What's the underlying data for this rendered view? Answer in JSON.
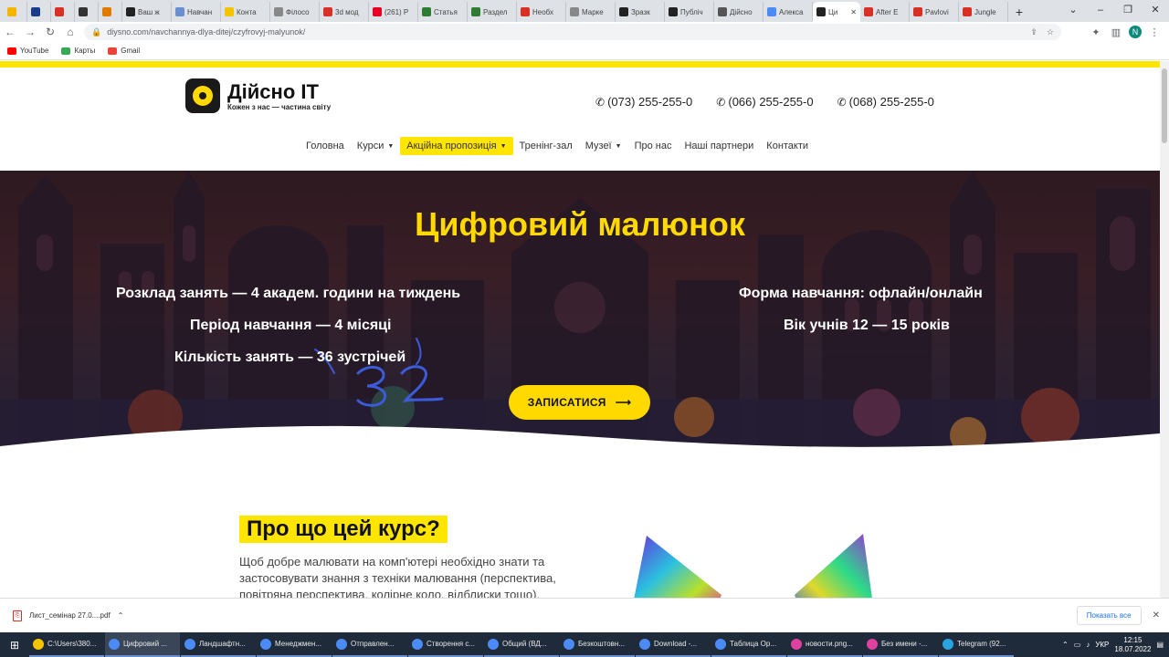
{
  "browser": {
    "tabs": [
      {
        "label": "",
        "color": "#f5b400"
      },
      {
        "label": "",
        "color": "#1a3c8a"
      },
      {
        "label": "",
        "color": "#d93025"
      },
      {
        "label": "",
        "color": "#333333"
      },
      {
        "label": "",
        "color": "#e07b00"
      },
      {
        "label": "Ваш ж",
        "color": "#222222"
      },
      {
        "label": "Навчан",
        "color": "#6a8fcf"
      },
      {
        "label": "Конта",
        "color": "#f5c400"
      },
      {
        "label": "Філосо",
        "color": "#888888"
      },
      {
        "label": "3d мод",
        "color": "#d93025"
      },
      {
        "label": "(261) P",
        "color": "#e60023"
      },
      {
        "label": "Статья",
        "color": "#2e7d32"
      },
      {
        "label": "Раздел",
        "color": "#2e7d32"
      },
      {
        "label": "Необх",
        "color": "#d93025"
      },
      {
        "label": "Марке",
        "color": "#888888"
      },
      {
        "label": "Зразк",
        "color": "#222222"
      },
      {
        "label": "Публіч",
        "color": "#222222"
      },
      {
        "label": "Дійсно",
        "color": "#555555"
      },
      {
        "label": "Алекса",
        "color": "#4c8bf5"
      },
      {
        "label": "Ци",
        "color": "#222222",
        "active": true
      },
      {
        "label": "After E",
        "color": "#d93025"
      },
      {
        "label": "Pavlovi",
        "color": "#d93025"
      },
      {
        "label": "Jungle",
        "color": "#d93025"
      }
    ],
    "url": "diysno.com/navchannya-dlya-ditej/czyfrovyj-malyunok/",
    "profile_initial": "N",
    "bookmarks": [
      {
        "label": "YouTube",
        "color": "#ff0000"
      },
      {
        "label": "Карты",
        "color": "#34a853"
      },
      {
        "label": "Gmail",
        "color": "#ea4335"
      }
    ]
  },
  "site": {
    "logo_title": "Дійсно IT",
    "logo_sub": "Кожен з нас — частина світу",
    "phones": [
      "(073) 255-255-0",
      "(066) 255-255-0",
      "(068) 255-255-0"
    ],
    "nav": [
      {
        "label": "Головна"
      },
      {
        "label": "Курси",
        "dropdown": true
      },
      {
        "label": "Акційна пропозиція",
        "dropdown": true,
        "highlight": true
      },
      {
        "label": "Тренінг-зал"
      },
      {
        "label": "Музеї",
        "dropdown": true
      },
      {
        "label": "Про нас"
      },
      {
        "label": "Наші партнери"
      },
      {
        "label": "Контакти"
      }
    ],
    "hero": {
      "title": "Цифровий малюнок",
      "schedule": "Розклад занять — 4 академ. години на тиждень",
      "period": "Період навчання — 4 місяці",
      "count": "Кількість занять — 36 зустрічей",
      "handwritten": "32",
      "form": "Форма навчання: офлайн/онлайн",
      "age": "Вік учнів 12 — 15 років",
      "cta": "ЗАПИСАТИСЯ"
    },
    "about": {
      "title": "Про що цей курс?",
      "text": "Щоб добре малювати на комп'ютері необхідно знати та застосовувати знання з техніки малювання (перспектива, повітряна перспектива, колірне коло, відблиски тощо)."
    }
  },
  "downloads": {
    "file": "Лист_семінар 27.0....pdf",
    "show_all": "Показать все"
  },
  "taskbar": {
    "items": [
      {
        "label": "C:\\Users\\380...",
        "color": "#f5c400"
      },
      {
        "label": "Цифровий ...",
        "color": "#4c8bf5",
        "active": true
      },
      {
        "label": "Ландшафтн...",
        "color": "#4c8bf5"
      },
      {
        "label": "Менеджмен...",
        "color": "#4c8bf5"
      },
      {
        "label": "Отправлен...",
        "color": "#4c8bf5"
      },
      {
        "label": "Створення с...",
        "color": "#4c8bf5"
      },
      {
        "label": "Общий (ВД...",
        "color": "#4c8bf5"
      },
      {
        "label": "Безкоштовн...",
        "color": "#4c8bf5"
      },
      {
        "label": "Download -...",
        "color": "#4c8bf5"
      },
      {
        "label": "Таблица Ор...",
        "color": "#4c8bf5"
      },
      {
        "label": "новости.png...",
        "color": "#e040a0"
      },
      {
        "label": "Без имени -...",
        "color": "#e040a0"
      },
      {
        "label": "Telegram (92...",
        "color": "#2aa3e0"
      }
    ],
    "lang": "УКР",
    "time": "12:15",
    "date": "18.07.2022"
  }
}
